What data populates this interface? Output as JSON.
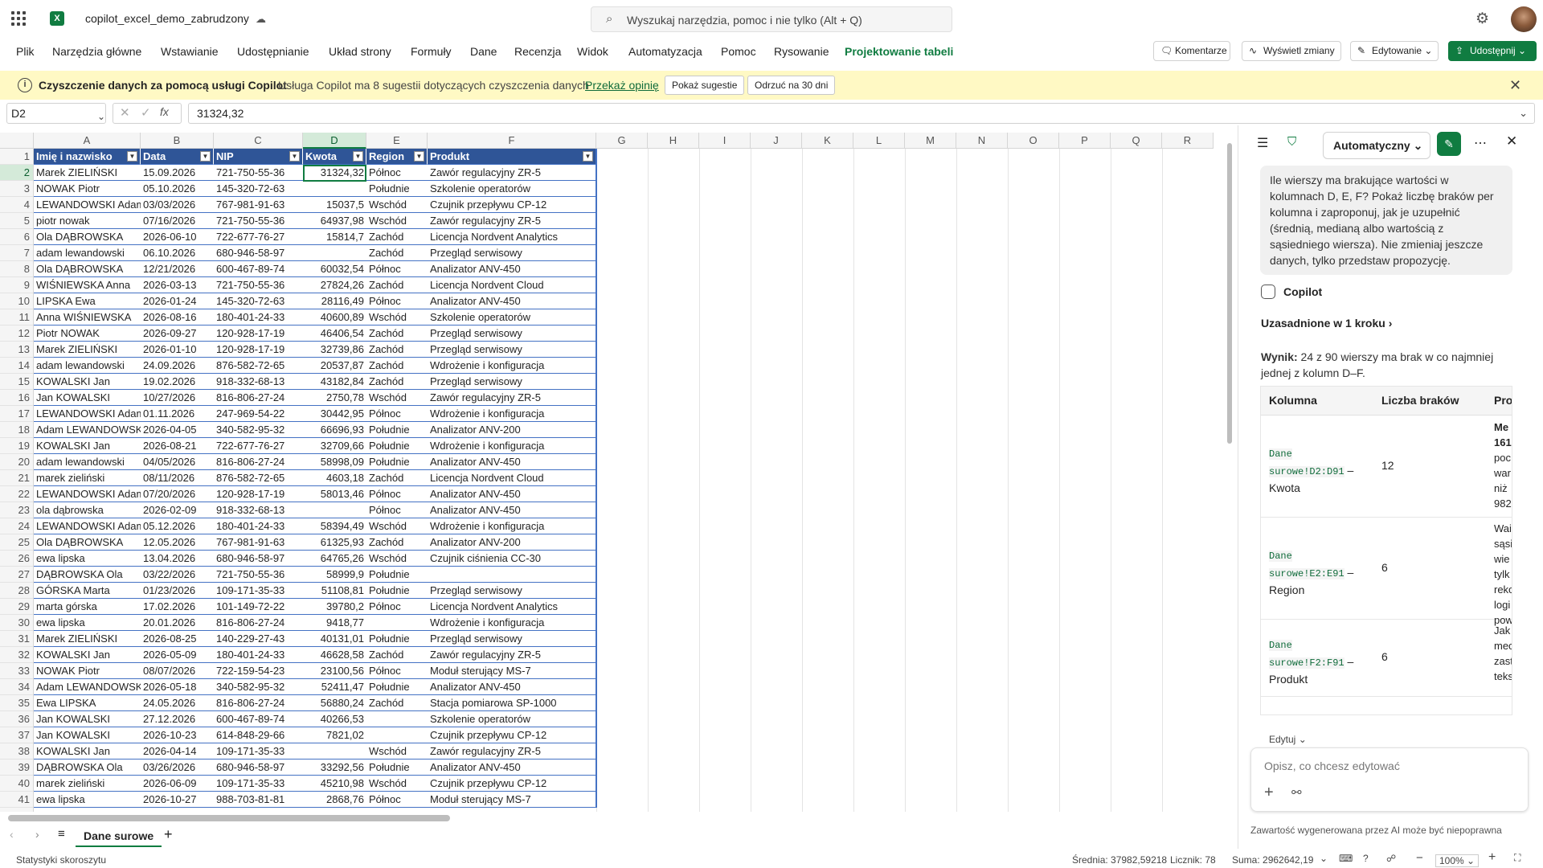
{
  "title_bar": {
    "doc_title": "copilot_excel_demo_zabrudzony",
    "search_placeholder": "Wyszukaj narzędzia, pomoc i nie tylko (Alt + Q)"
  },
  "menu": [
    "Plik",
    "Narzędzia główne",
    "Wstawianie",
    "Udostępnianie",
    "Układ strony",
    "Formuły",
    "Dane",
    "Recenzja",
    "Widok",
    "Automatyzacja",
    "Pomoc",
    "Rysowanie",
    "Projektowanie tabeli"
  ],
  "ribbon_right": {
    "comments": "Komentarze",
    "changes": "Wyświetl zmiany",
    "editing": "Edytowanie",
    "share": "Udostępnij"
  },
  "infobar": {
    "title": "Czyszczenie danych za pomocą usługi Copilot",
    "message": "Usługa Copilot ma 8 sugestii dotyczących czyszczenia danych",
    "link": "Przekaż opinię",
    "show_btn": "Pokaż sugestie",
    "dismiss_btn": "Odrzuć na 30 dni"
  },
  "formula_bar": {
    "name_box": "D2",
    "formula": "31324,32",
    "fx": "fx"
  },
  "columns": [
    "A",
    "B",
    "C",
    "D",
    "E",
    "F",
    "G",
    "H",
    "I",
    "J",
    "K",
    "L",
    "M",
    "N",
    "O",
    "P",
    "Q",
    "R"
  ],
  "table_headers": [
    "Imię i nazwisko",
    "Data",
    "NIP",
    "Kwota",
    "Region",
    "Produkt"
  ],
  "rows": [
    [
      "Marek ZIELIŃSKI",
      "15.09.2026",
      "721-750-55-36",
      "31324,32",
      "Północ",
      "Zawór regulacyjny ZR-5"
    ],
    [
      "NOWAK Piotr",
      "05.10.2026",
      "145-320-72-63",
      "",
      "Południe",
      "Szkolenie operatorów"
    ],
    [
      "LEWANDOWSKI Adam",
      "03/03/2026",
      "767-981-91-63",
      "15037,5",
      "Wschód",
      "Czujnik przepływu CP-12"
    ],
    [
      "piotr nowak",
      "07/16/2026",
      "721-750-55-36",
      "64937,98",
      "Wschód",
      "Zawór regulacyjny ZR-5"
    ],
    [
      "Ola DĄBROWSKA",
      "2026-06-10",
      "722-677-76-27",
      "15814,7",
      "Zachód",
      "Licencja Nordvent Analytics"
    ],
    [
      "adam lewandowski",
      "06.10.2026",
      "680-946-58-97",
      "",
      "Zachód",
      "Przegląd serwisowy"
    ],
    [
      "Ola DĄBROWSKA",
      "12/21/2026",
      "600-467-89-74",
      "60032,54",
      "Północ",
      "Analizator ANV-450"
    ],
    [
      "WIŚNIEWSKA Anna",
      "2026-03-13",
      "721-750-55-36",
      "27824,26",
      "Zachód",
      "Licencja Nordvent Cloud"
    ],
    [
      "LIPSKA Ewa",
      "2026-01-24",
      "145-320-72-63",
      "28116,49",
      "Północ",
      "Analizator ANV-450"
    ],
    [
      "Anna WIŚNIEWSKA",
      "2026-08-16",
      "180-401-24-33",
      "40600,89",
      "Wschód",
      "Szkolenie operatorów"
    ],
    [
      "Piotr NOWAK",
      "2026-09-27",
      "120-928-17-19",
      "46406,54",
      "Zachód",
      "Przegląd serwisowy"
    ],
    [
      "Marek ZIELIŃSKI",
      "2026-01-10",
      "120-928-17-19",
      "32739,86",
      "Zachód",
      "Przegląd serwisowy"
    ],
    [
      "adam lewandowski",
      "24.09.2026",
      "876-582-72-65",
      "20537,87",
      "Zachód",
      "Wdrożenie i konfiguracja"
    ],
    [
      "KOWALSKI Jan",
      "19.02.2026",
      "918-332-68-13",
      "43182,84",
      "Zachód",
      "Przegląd serwisowy"
    ],
    [
      "Jan KOWALSKI",
      "10/27/2026",
      "816-806-27-24",
      "2750,78",
      "Wschód",
      "Zawór regulacyjny ZR-5"
    ],
    [
      "LEWANDOWSKI Adam",
      "01.11.2026",
      "247-969-54-22",
      "30442,95",
      "Północ",
      "Wdrożenie i konfiguracja"
    ],
    [
      "Adam LEWANDOWSKI",
      "2026-04-05",
      "340-582-95-32",
      "66696,93",
      "Południe",
      "Analizator ANV-200"
    ],
    [
      "KOWALSKI Jan",
      "2026-08-21",
      "722-677-76-27",
      "32709,66",
      "Południe",
      "Wdrożenie i konfiguracja"
    ],
    [
      "adam lewandowski",
      "04/05/2026",
      "816-806-27-24",
      "58998,09",
      "Południe",
      "Analizator ANV-450"
    ],
    [
      "marek zieliński",
      "08/11/2026",
      "876-582-72-65",
      "4603,18",
      "Zachód",
      "Licencja Nordvent Cloud"
    ],
    [
      "LEWANDOWSKI Adam",
      "07/20/2026",
      "120-928-17-19",
      "58013,46",
      "Północ",
      "Analizator ANV-450"
    ],
    [
      "ola dąbrowska",
      "2026-02-09",
      "918-332-68-13",
      "",
      "Północ",
      "Analizator ANV-450"
    ],
    [
      "LEWANDOWSKI Adam",
      "05.12.2026",
      "180-401-24-33",
      "58394,49",
      "Wschód",
      "Wdrożenie i konfiguracja"
    ],
    [
      "Ola DĄBROWSKA",
      "12.05.2026",
      "767-981-91-63",
      "61325,93",
      "Zachód",
      "Analizator ANV-200"
    ],
    [
      "ewa lipska",
      "13.04.2026",
      "680-946-58-97",
      "64765,26",
      "Wschód",
      "Czujnik ciśnienia CC-30"
    ],
    [
      "DĄBROWSKA Ola",
      "03/22/2026",
      "721-750-55-36",
      "58999,9",
      "Południe",
      ""
    ],
    [
      "GÓRSKA Marta",
      "01/23/2026",
      "109-171-35-33",
      "51108,81",
      "Południe",
      "Przegląd serwisowy"
    ],
    [
      "marta górska",
      "17.02.2026",
      "101-149-72-22",
      "39780,2",
      "Północ",
      "Licencja Nordvent Analytics"
    ],
    [
      "ewa lipska",
      "20.01.2026",
      "816-806-27-24",
      "9418,77",
      "",
      "Wdrożenie i konfiguracja"
    ],
    [
      "Marek ZIELIŃSKI",
      "2026-08-25",
      "140-229-27-43",
      "40131,01",
      "Południe",
      "Przegląd serwisowy"
    ],
    [
      "KOWALSKI Jan",
      "2026-05-09",
      "180-401-24-33",
      "46628,58",
      "Zachód",
      "Zawór regulacyjny ZR-5"
    ],
    [
      "NOWAK Piotr",
      "08/07/2026",
      "722-159-54-23",
      "23100,56",
      "Północ",
      "Moduł sterujący MS-7"
    ],
    [
      "Adam LEWANDOWSKI",
      "2026-05-18",
      "340-582-95-32",
      "52411,47",
      "Południe",
      "Analizator ANV-450"
    ],
    [
      "Ewa LIPSKA",
      "24.05.2026",
      "816-806-27-24",
      "56880,24",
      "Zachód",
      "Stacja pomiarowa SP-1000"
    ],
    [
      "Jan KOWALSKI",
      "27.12.2026",
      "600-467-89-74",
      "40266,53",
      "",
      "Szkolenie operatorów"
    ],
    [
      "Jan KOWALSKI",
      "2026-10-23",
      "614-848-29-66",
      "7821,02",
      "",
      "Czujnik przepływu CP-12"
    ],
    [
      "KOWALSKI Jan",
      "2026-04-14",
      "109-171-35-33",
      "",
      "Wschód",
      "Zawór regulacyjny ZR-5"
    ],
    [
      "DĄBROWSKA Ola",
      "03/26/2026",
      "680-946-58-97",
      "33292,56",
      "Południe",
      "Analizator ANV-450"
    ],
    [
      "marek zieliński",
      "2026-06-09",
      "109-171-35-33",
      "45210,98",
      "Wschód",
      "Czujnik przepływu CP-12"
    ],
    [
      "ewa lipska",
      "2026-10-27",
      "988-703-81-81",
      "2868,76",
      "Północ",
      "Moduł sterujący MS-7"
    ]
  ],
  "sheet_tabs": {
    "active": "Dane surowe"
  },
  "status_bar": {
    "left": "Statystyki skoroszytu",
    "average": "Średnia: 37982,59218",
    "count": "Licznik: 78",
    "sum": "Suma: 2962642,19",
    "zoom": "100%"
  },
  "copilot": {
    "mode": "Automatyczny",
    "user_message": "Ile wierszy ma brakujące wartości w kolumnach D, E, F? Pokaż liczbę braków per kolumna i zaproponuj, jak je uzupełnić (średnią, medianą albo wartością z sąsiedniego wiersza). Nie zmieniaj jeszcze danych, tylko przedstaw propozycję.",
    "name": "Copilot",
    "grounded": "Uzasadnione w 1 kroku",
    "result_label": "Wynik:",
    "result_text": " 24 z 90 wierszy ma brak w co najmniej jednej z kolumn D–F.",
    "table_headers": [
      "Kolumna",
      "Liczba braków",
      "Pro"
    ],
    "table_rows": [
      {
        "code1": "Dane",
        "code2": "surowe!D2:D91",
        "name": "Kwota",
        "count": "12",
        "proposal_lines": [
          "Me",
          "161,",
          "poc",
          "war",
          "niż",
          "982"
        ]
      },
      {
        "code1": "Dane",
        "code2": "surowe!E2:E91",
        "name": "Region",
        "count": "6",
        "proposal_lines": [
          "Wai",
          "sąsi",
          "wie",
          "tylk",
          "reko",
          "logi",
          "pow"
        ]
      },
      {
        "code1": "Dane",
        "code2": "surowe!F2:F91",
        "name": "Produkt",
        "count": "6",
        "proposal_lines": [
          "Jak",
          "mec",
          "zast",
          "teks"
        ]
      }
    ],
    "edit_label": "Edytuj",
    "input_placeholder": "Opisz, co chcesz edytować",
    "disclaimer": "Zawartość wygenerowana przez AI może być niepoprawna"
  }
}
